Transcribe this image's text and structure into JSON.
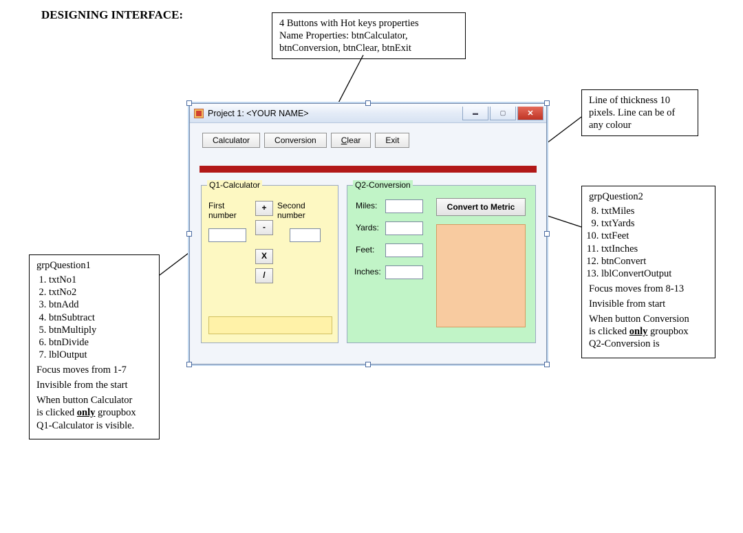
{
  "heading": "DESIGNING INTERFACE:",
  "callouts": {
    "topButtons": {
      "line1": "4 Buttons with Hot keys properties",
      "line2": "Name Properties: btnCalculator,",
      "line3": "btnConversion, btnClear, btnExit"
    },
    "redLine": {
      "line1": "Line of thickness 10",
      "line2": "pixels. Line can be of",
      "line3": "any colour"
    },
    "grp1": {
      "title": "grpQuestion1",
      "items": [
        "txtNo1",
        "txtNo2",
        "btnAdd",
        "btnSubtract",
        "btnMultiply",
        "btnDivide",
        "lblOutput"
      ],
      "focus": "Focus moves from 1-7",
      "invisible": "Invisible from the start",
      "note1": "When button Calculator",
      "note2a": "is clicked ",
      "note2b_only": "only",
      "note2c": " groupbox",
      "note3": "Q1-Calculator is visible."
    },
    "grp2": {
      "title": "grpQuestion2",
      "items": [
        "txtMiles",
        "txtYards",
        "txtFeet",
        "txtInches",
        "btnConvert",
        "lblConvertOutput"
      ],
      "items_start": 8,
      "focus": "Focus moves from 8-13",
      "invisible": "Invisible from start",
      "note1": "When button Conversion",
      "note2a": "is clicked ",
      "note2b_only": "only",
      "note2c": " groupbox",
      "note3": "Q2-Conversion is"
    }
  },
  "window": {
    "title": "Project 1: <YOUR NAME>",
    "buttons": {
      "calculator": "Calculator",
      "conversion": "Conversion",
      "clear": "Clea_r",
      "clear_display": "Clear",
      "exit": "Exit"
    },
    "q1": {
      "group_title": "Q1-Calculator",
      "first": "First\nnumber",
      "second": "Second\nnumber",
      "add": "+",
      "sub": "-",
      "mul": "X",
      "div": "/"
    },
    "q2": {
      "group_title": "Q2-Conversion",
      "miles": "Miles:",
      "yards": "Yards:",
      "feet": "Feet:",
      "inches": "Inches:",
      "convert": "Convert to Metric"
    }
  }
}
